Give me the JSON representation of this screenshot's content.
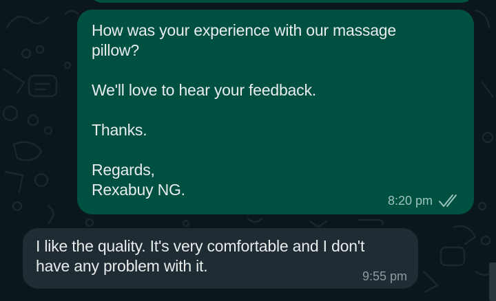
{
  "colors": {
    "background": "#0c171b",
    "outgoing_bubble": "#005042",
    "incoming_bubble": "#1f2c33",
    "text": "#e8eceb",
    "read_ticks": "#9cc6bc"
  },
  "messages": [
    {
      "direction": "outgoing",
      "lines": [
        "How was your experience with our massage",
        "pillow?",
        "",
        "We'll love to hear your feedback.",
        "",
        "Thanks.",
        "",
        "Regards,",
        "Rexabuy NG."
      ],
      "time": "8:20 pm",
      "status_icon": "double-check-icon"
    },
    {
      "direction": "incoming",
      "lines": [
        "I like the quality. It's very comfortable and I don't",
        "have any problem with it."
      ],
      "time": "9:55 pm"
    }
  ]
}
